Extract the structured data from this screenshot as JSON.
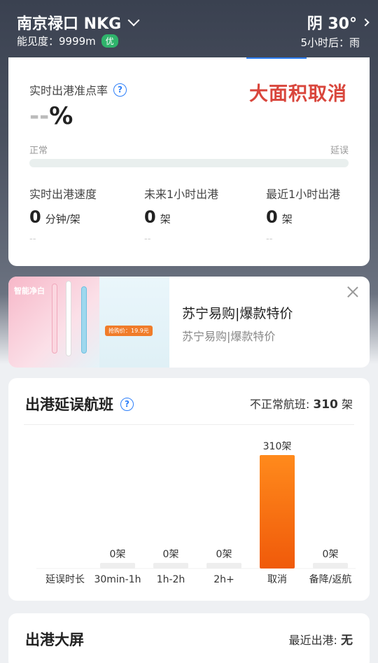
{
  "header": {
    "airport": "南京禄口 NKG",
    "visibility_label": "能见度：9999m",
    "visibility_badge": "优",
    "weather": "阴 30°",
    "forecast": "5小时后：雨"
  },
  "punctuality": {
    "label": "实时出港准点率",
    "value_dash": "--",
    "value_unit": "%",
    "alert": "大面积取消",
    "scale_left": "正常",
    "scale_right": "延误",
    "stats": [
      {
        "title": "实时出港速度",
        "value": "0",
        "unit": "分钟/架",
        "delta": "--"
      },
      {
        "title": "未来1小时出港",
        "value": "0",
        "unit": "架",
        "delta": "--"
      },
      {
        "title": "最近1小时出港",
        "value": "0",
        "unit": "架",
        "delta": "--"
      }
    ]
  },
  "ad": {
    "title": "苏宁易购|爆款特价",
    "subtitle": "苏宁易购|爆款特价",
    "img_text1": "智能净白",
    "img_text2": "抢购价：19.9元"
  },
  "delay_section": {
    "title": "出港延误航班",
    "right_label": "不正常航班:",
    "right_value": "310",
    "right_unit": "架"
  },
  "chart_data": {
    "type": "bar",
    "axis_label": "延误时长",
    "categories": [
      "30min-1h",
      "1h-2h",
      "2h+",
      "取消",
      "备降/返航"
    ],
    "values": [
      0,
      0,
      0,
      310,
      0
    ],
    "labels": [
      "0架",
      "0架",
      "0架",
      "310架",
      "0架"
    ],
    "ylim": [
      0,
      310
    ],
    "colors": {
      "active": "#f05a0a",
      "active_top": "#ff8a1c",
      "empty": "#eeeeee"
    }
  },
  "board": {
    "title": "出港大屏",
    "right_label": "最近出港:",
    "right_value": "无"
  }
}
